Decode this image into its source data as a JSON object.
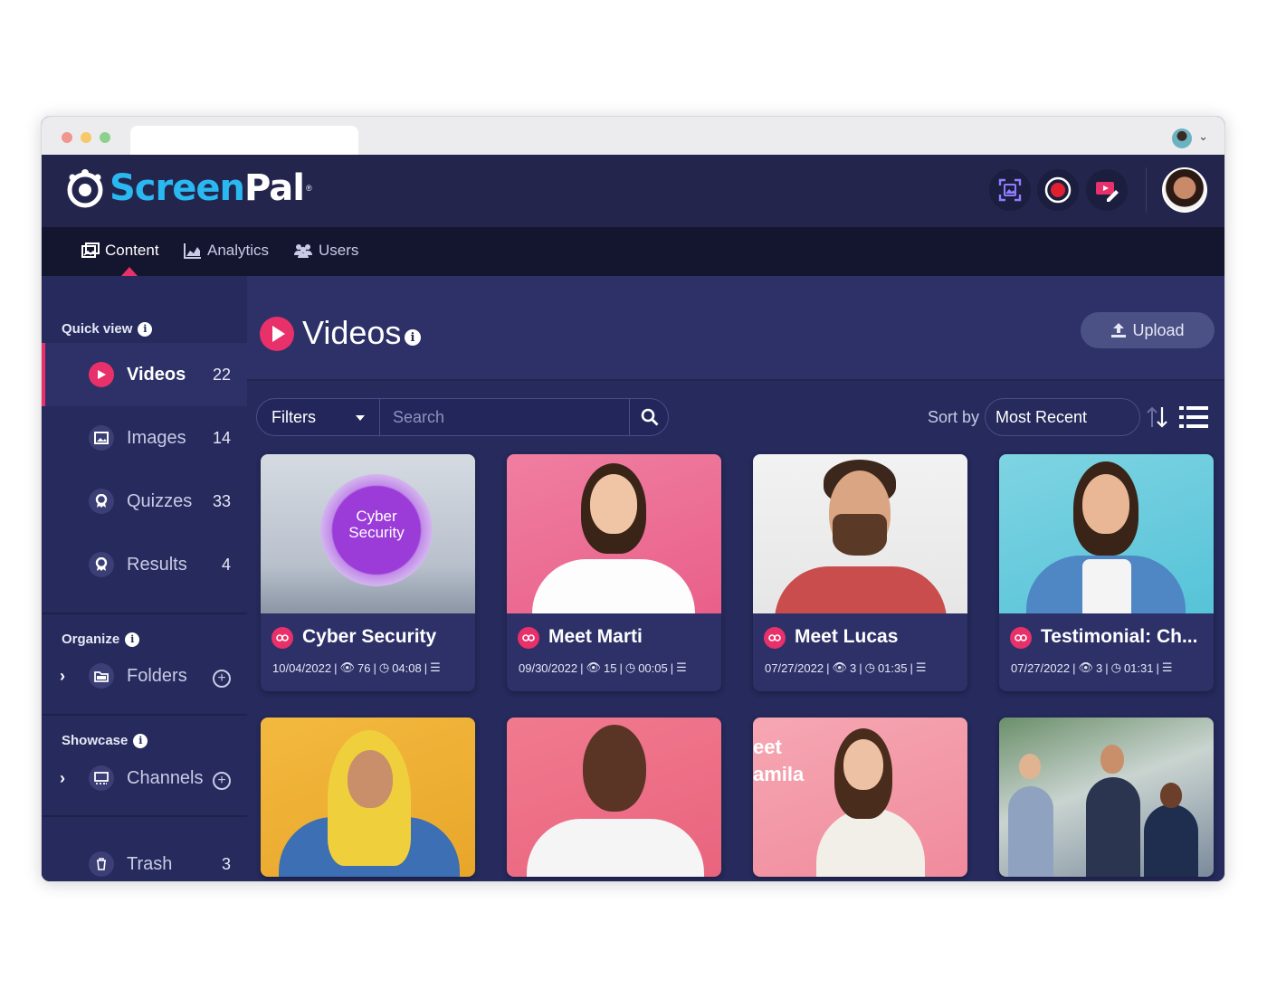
{
  "app": {
    "brand_prefix": "Screen",
    "brand_suffix": "Pal",
    "brand_reg": "®"
  },
  "nav": {
    "tabs": [
      {
        "label": "Content",
        "icon": "image-gallery-icon",
        "active": true
      },
      {
        "label": "Analytics",
        "icon": "area-chart-icon",
        "active": false
      },
      {
        "label": "Users",
        "icon": "users-icon",
        "active": false
      }
    ]
  },
  "header_actions": [
    {
      "icon": "screenshot-icon"
    },
    {
      "icon": "record-icon"
    },
    {
      "icon": "video-editor-icon"
    }
  ],
  "sidebar": {
    "quick_view_label": "Quick view",
    "items": [
      {
        "label": "Videos",
        "count": "22",
        "icon": "play-icon",
        "active": true
      },
      {
        "label": "Images",
        "count": "14",
        "icon": "image-icon",
        "active": false
      },
      {
        "label": "Quizzes",
        "count": "33",
        "icon": "quiz-icon",
        "active": false
      },
      {
        "label": "Results",
        "count": "4",
        "icon": "results-icon",
        "active": false
      }
    ],
    "organize_label": "Organize",
    "folders_label": "Folders",
    "showcase_label": "Showcase",
    "channels_label": "Channels",
    "trash_label": "Trash",
    "trash_count": "3"
  },
  "main": {
    "title": "Videos",
    "upload_label": "Upload",
    "filters_label": "Filters",
    "search_placeholder": "Search",
    "sort_by_label": "Sort by",
    "sort_value": "Most Recent"
  },
  "cards": [
    {
      "title": "Cyber Security",
      "date": "10/04/2022",
      "views": "76",
      "duration": "04:08",
      "thumb_text_line1": "Cyber",
      "thumb_text_line2": "Security"
    },
    {
      "title": "Meet Marti",
      "date": "09/30/2022",
      "views": "15",
      "duration": "00:05"
    },
    {
      "title": "Meet Lucas",
      "date": "07/27/2022",
      "views": "3",
      "duration": "01:35"
    },
    {
      "title": "Testimonial: Ch...",
      "date": "07/27/2022",
      "views": "3",
      "duration": "01:31"
    },
    {
      "title": "",
      "date": "",
      "views": "",
      "duration": ""
    },
    {
      "title": "",
      "date": "",
      "views": "",
      "duration": ""
    },
    {
      "title": "",
      "date": "",
      "views": "",
      "duration": "",
      "thumb_text_line1": "eet",
      "thumb_text_line2": "amila"
    },
    {
      "title": "",
      "date": "",
      "views": "",
      "duration": ""
    }
  ],
  "colors": {
    "accent": "#e8306a",
    "brand_blue": "#2ab8f0",
    "background": "#262a5c",
    "header": "#23254d",
    "navbar": "#14152e"
  }
}
